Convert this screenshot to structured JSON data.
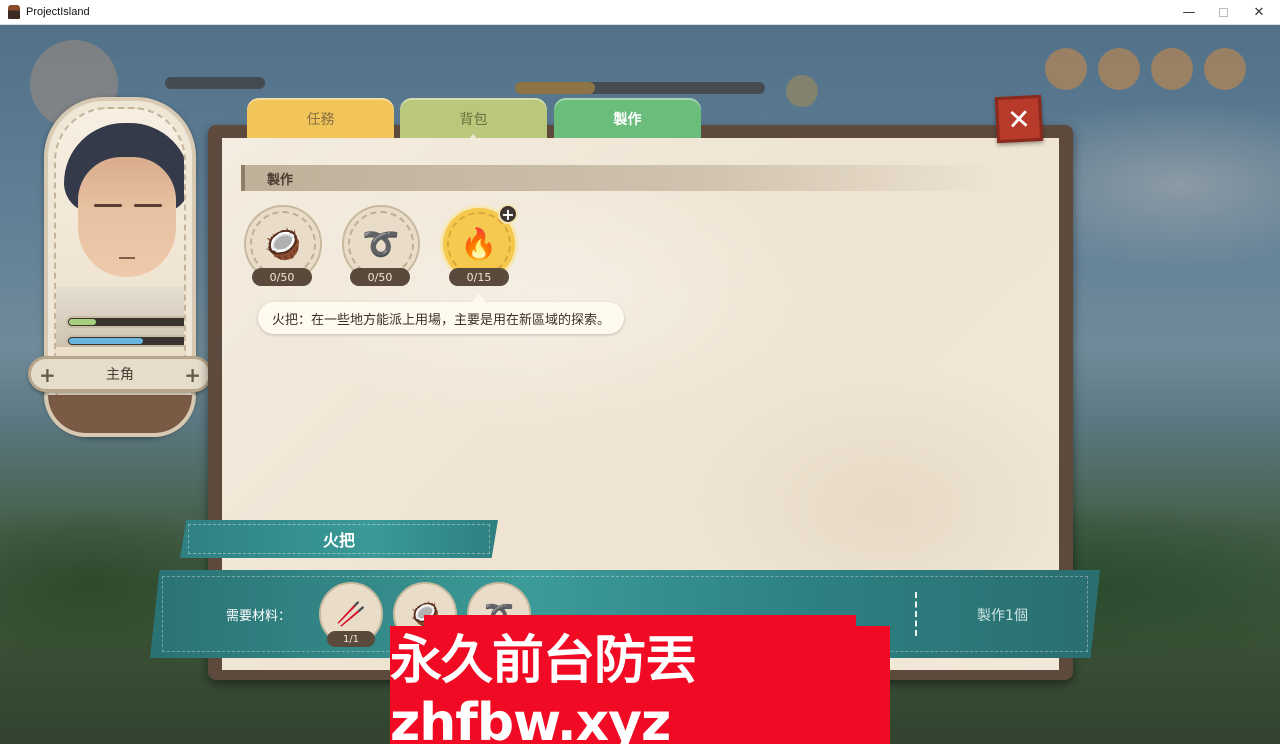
{
  "window": {
    "title": "ProjectIsland",
    "minimize_icon": "—",
    "close_icon": "✕"
  },
  "character": {
    "name": "主角",
    "hp_fraction": 0.22,
    "mp_fraction": 0.6
  },
  "tabs": [
    {
      "label": "任務"
    },
    {
      "label": "背包"
    },
    {
      "label": "製作"
    }
  ],
  "active_tab": "製作",
  "close_label": "✕",
  "section_title": "製作",
  "recipes": [
    {
      "icon": "coconut-icon",
      "glyph": "🥥",
      "count": "0/50"
    },
    {
      "icon": "rope-icon",
      "glyph": "➰",
      "count": "0/50"
    },
    {
      "icon": "torch-icon",
      "glyph": "🔥",
      "count": "0/15"
    }
  ],
  "add_label": "+",
  "tooltip": "火把：在一些地方能派上用場，主要是用在新區域的探索。",
  "selected_item": {
    "name": "火把",
    "materials_label": "需要材料：",
    "materials": [
      {
        "icon": "stick-icon",
        "glyph": "🥢",
        "count": "1/1"
      },
      {
        "icon": "coconut-icon",
        "glyph": "🥥"
      },
      {
        "icon": "rope-icon",
        "glyph": "➰"
      }
    ],
    "craft_button": "製作1個"
  },
  "watermark": "永久前台防丟zhfbw.xyz"
}
